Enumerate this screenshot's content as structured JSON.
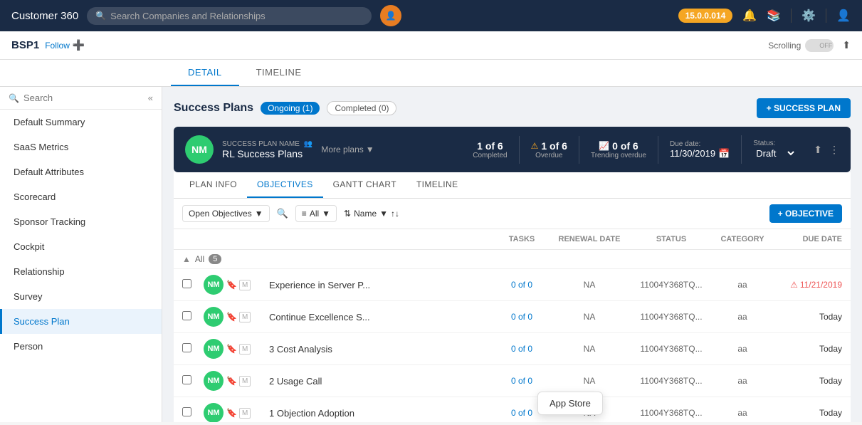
{
  "app": {
    "title": "Customer 360",
    "version": "15.0.0.014",
    "search_placeholder": "Search Companies and Relationships"
  },
  "sub_nav": {
    "company_name": "BSP1",
    "follow_label": "Follow",
    "scrolling_label": "Scrolling",
    "off_label": "OFF"
  },
  "main_tabs": [
    {
      "label": "DETAIL",
      "active": true
    },
    {
      "label": "TIMELINE",
      "active": false
    }
  ],
  "sidebar": {
    "search_placeholder": "Search",
    "items": [
      {
        "label": "Default Summary",
        "active": false
      },
      {
        "label": "SaaS Metrics",
        "active": false
      },
      {
        "label": "Default Attributes",
        "active": false
      },
      {
        "label": "Scorecard",
        "active": false
      },
      {
        "label": "Sponsor Tracking",
        "active": false
      },
      {
        "label": "Cockpit",
        "active": false
      },
      {
        "label": "Relationship",
        "active": false
      },
      {
        "label": "Survey",
        "active": false
      },
      {
        "label": "Success Plan",
        "active": true
      },
      {
        "label": "Person",
        "active": false
      }
    ]
  },
  "success_plans": {
    "title": "Success Plans",
    "ongoing_label": "Ongoing (1)",
    "completed_label": "Completed (0)",
    "add_btn_label": "+ SUCCESS PLAN"
  },
  "plan": {
    "avatar_initials": "NM",
    "name_label": "SUCCESS PLAN NAME",
    "name": "RL Success Plans",
    "more_plans_label": "More plans",
    "stats": [
      {
        "number": "1 of 6",
        "label": "Completed"
      },
      {
        "number": "1 of 6",
        "label": "Overdue",
        "warn": true
      },
      {
        "number": "0 of 6",
        "label": "Trending overdue",
        "trend": true
      }
    ],
    "due_label": "Due date:",
    "due_value": "11/30/2019",
    "status_label": "Status:",
    "status_value": "Draft"
  },
  "plan_tabs": [
    {
      "label": "PLAN INFO",
      "active": false
    },
    {
      "label": "OBJECTIVES",
      "active": true
    },
    {
      "label": "GANTT CHART",
      "active": false
    },
    {
      "label": "TIMELINE",
      "active": false
    }
  ],
  "objectives": {
    "filter_label": "Open Objectives",
    "all_filter_label": "All",
    "sort_label": "Name",
    "add_btn_label": "+ OBJECTIVE",
    "all_count": 5,
    "columns": {
      "tasks": "Tasks",
      "renewal_date": "Renewal Date",
      "status": "Status",
      "category": "Category",
      "due_date": "Due Date"
    },
    "rows": [
      {
        "initials": "NM",
        "name": "Experience in Server P...",
        "tasks": "0 of 0",
        "renewal": "NA",
        "status": "11004Y368TQ...",
        "category": "aa",
        "due_date": "11/21/2019",
        "overdue": true
      },
      {
        "initials": "NM",
        "name": "Continue Excellence S...",
        "tasks": "0 of 0",
        "renewal": "NA",
        "status": "11004Y368TQ...",
        "category": "aa",
        "due_date": "Today",
        "overdue": false
      },
      {
        "initials": "NM",
        "name": "3 Cost Analysis",
        "tasks": "0 of 0",
        "renewal": "NA",
        "status": "11004Y368TQ...",
        "category": "aa",
        "due_date": "Today",
        "overdue": false
      },
      {
        "initials": "NM",
        "name": "2 Usage Call",
        "tasks": "0 of 0",
        "renewal": "NA",
        "status": "11004Y368TQ...",
        "category": "aa",
        "due_date": "Today",
        "overdue": false
      },
      {
        "initials": "NM",
        "name": "1 Objection Adoption",
        "tasks": "0 of 0",
        "renewal": "NA",
        "status": "11004Y368TQ...",
        "category": "aa",
        "due_date": "Today",
        "overdue": false
      }
    ]
  },
  "tooltip": {
    "text": "App Store"
  }
}
